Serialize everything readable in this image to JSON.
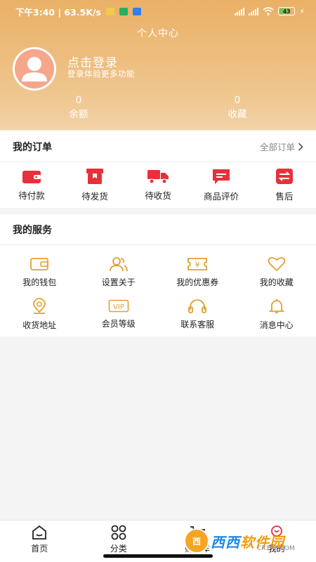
{
  "status_bar": {
    "time_network": "下午3:40 | 63.5K/s",
    "battery": "43"
  },
  "page_title": "个人中心",
  "user": {
    "login_title": "点击登录",
    "login_subtitle": "登录体验更多功能"
  },
  "stats": [
    {
      "value": "0",
      "label": "余额"
    },
    {
      "value": "0",
      "label": "收藏"
    }
  ],
  "orders": {
    "title": "我的订单",
    "all_label": "全部订单",
    "items": [
      {
        "label": "待付款",
        "icon": "wallet-icon"
      },
      {
        "label": "待发货",
        "icon": "package-icon"
      },
      {
        "label": "待收货",
        "icon": "truck-icon"
      },
      {
        "label": "商品评价",
        "icon": "message-icon"
      },
      {
        "label": "售后",
        "icon": "exchange-icon"
      }
    ]
  },
  "services": {
    "title": "我的服务",
    "items": [
      {
        "label": "我的钱包",
        "icon": "wallet-icon"
      },
      {
        "label": "设置关于",
        "icon": "users-icon"
      },
      {
        "label": "我的优惠券",
        "icon": "coupon-icon"
      },
      {
        "label": "我的收藏",
        "icon": "heart-icon"
      },
      {
        "label": "收货地址",
        "icon": "location-icon"
      },
      {
        "label": "会员等级",
        "icon": "vip-icon"
      },
      {
        "label": "联系客服",
        "icon": "headset-icon"
      },
      {
        "label": "消息中心",
        "icon": "bell-icon"
      }
    ],
    "vip_text": "VIP",
    "coupon_text": "¥"
  },
  "tabbar": [
    {
      "label": "首页",
      "icon": "home-icon"
    },
    {
      "label": "分类",
      "icon": "grid-icon"
    },
    {
      "label": "购物车",
      "icon": "cart-icon"
    },
    {
      "label": "我的",
      "icon": "profile-icon"
    }
  ],
  "watermark": {
    "circle": "西",
    "text_blue": "西西",
    "text_orange": "软件园",
    "sub": "CR173.COM"
  },
  "colors": {
    "header_orange": "#eab066",
    "order_red": "#e8303a",
    "service_gold": "#e0a030"
  }
}
